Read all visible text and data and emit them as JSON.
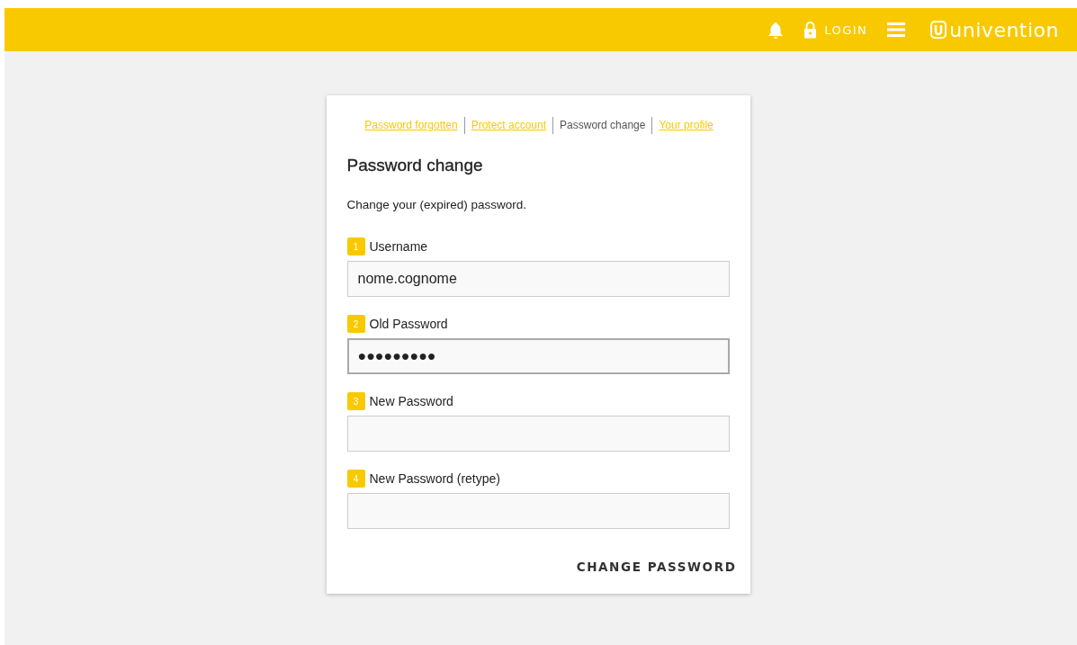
{
  "header": {
    "login": "LOGIN",
    "logo_text": "univention"
  },
  "card": {
    "tabs": [
      {
        "label": "Password forgotten",
        "selected": false
      },
      {
        "label": "Protect account",
        "selected": false
      },
      {
        "label": "Password change",
        "selected": true
      },
      {
        "label": "Your profile",
        "selected": false
      }
    ],
    "title": "Password change",
    "description": "Change your (expired) password.",
    "fields": [
      {
        "step": "1",
        "label": "Username",
        "value": "nome.cognome",
        "focused": false
      },
      {
        "step": "2",
        "label": "Old Password",
        "value": "●●●●●●●●●",
        "focused": true
      },
      {
        "step": "3",
        "label": "New Password",
        "focused": false
      },
      {
        "step": "4",
        "label": "New Password (retype)",
        "focused": false
      }
    ],
    "submit": "CHANGE PASSWORD"
  }
}
